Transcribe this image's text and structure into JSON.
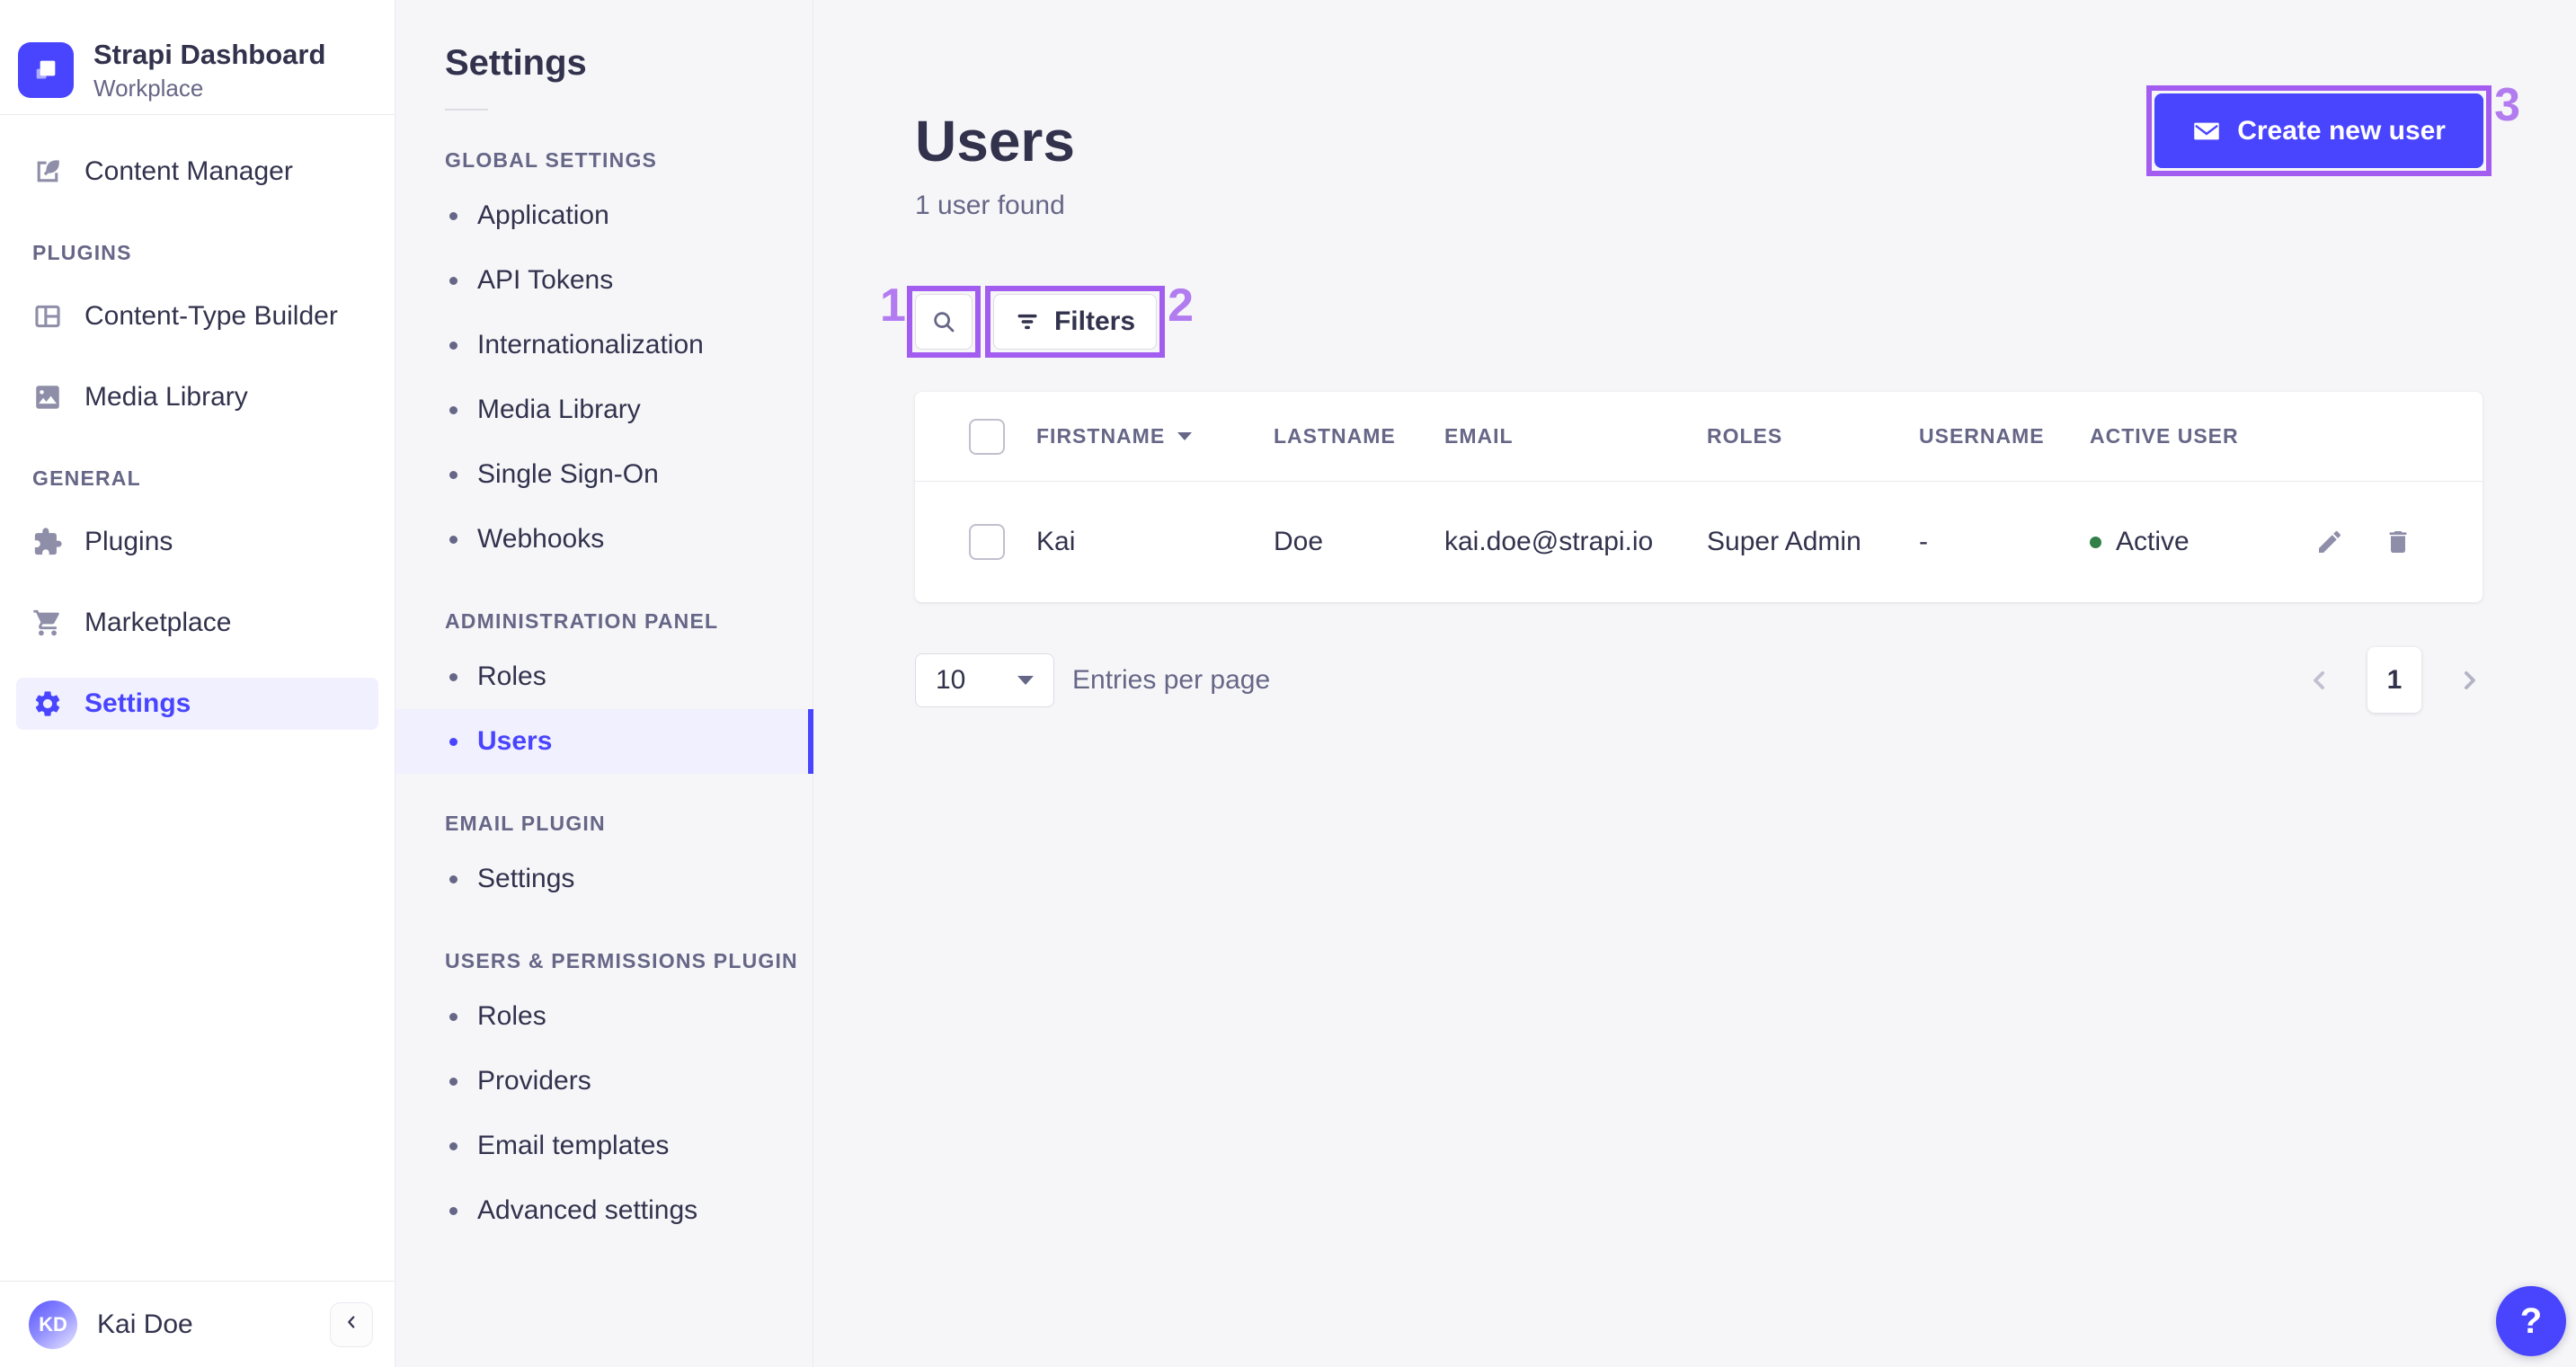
{
  "brand": {
    "title": "Strapi Dashboard",
    "subtitle": "Workplace"
  },
  "sidebar": {
    "content_manager": "Content Manager",
    "sections": [
      {
        "label": "PLUGINS",
        "items": [
          "Content-Type Builder",
          "Media Library"
        ]
      },
      {
        "label": "GENERAL",
        "items": [
          "Plugins",
          "Marketplace",
          "Settings"
        ]
      }
    ],
    "user": {
      "initials": "KD",
      "name": "Kai Doe"
    }
  },
  "subnav": {
    "title": "Settings",
    "sections": [
      {
        "label": "GLOBAL SETTINGS",
        "items": [
          "Application",
          "API Tokens",
          "Internationalization",
          "Media Library",
          "Single Sign-On",
          "Webhooks"
        ]
      },
      {
        "label": "ADMINISTRATION PANEL",
        "items": [
          "Roles",
          "Users"
        ]
      },
      {
        "label": "EMAIL PLUGIN",
        "items": [
          "Settings"
        ]
      },
      {
        "label": "USERS & PERMISSIONS PLUGIN",
        "items": [
          "Roles",
          "Providers",
          "Email templates",
          "Advanced settings"
        ]
      }
    ],
    "selected_item": "Users"
  },
  "main": {
    "title": "Users",
    "subtitle": "1 user found",
    "create_button": "Create new user",
    "filters_button": "Filters",
    "table": {
      "headers": [
        "FIRSTNAME",
        "LASTNAME",
        "EMAIL",
        "ROLES",
        "USERNAME",
        "ACTIVE USER"
      ],
      "rows": [
        {
          "firstname": "Kai",
          "lastname": "Doe",
          "email": "kai.doe@strapi.io",
          "roles": "Super Admin",
          "username": "-",
          "active": "Active"
        }
      ]
    },
    "pagination": {
      "page_size": "10",
      "entries_label": "Entries per page",
      "current_page": "1"
    }
  },
  "help": {
    "label": "?"
  },
  "annotations": [
    "1",
    "2",
    "3"
  ],
  "colors": {
    "accent": "#4945ff",
    "accent_bg": "#f0f0ff",
    "annotation": "#a35cf0",
    "success": "#328048",
    "text_dark": "#32324d",
    "text_muted": "#666687",
    "background": "#f6f6f9"
  }
}
